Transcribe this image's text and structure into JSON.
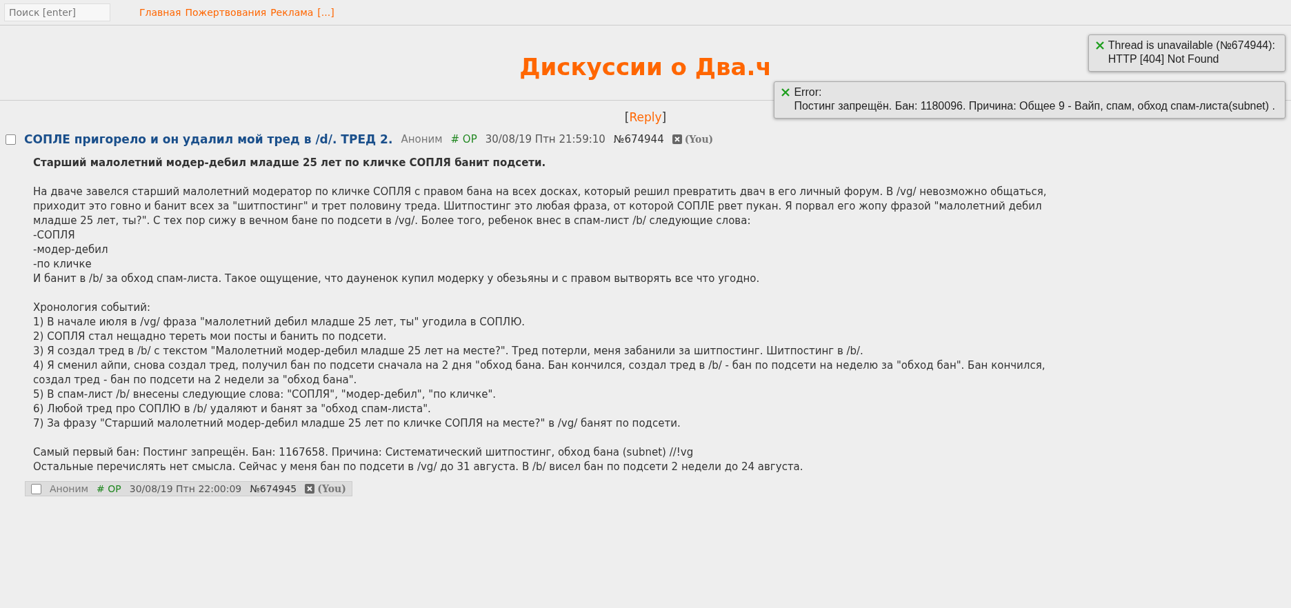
{
  "topbar": {
    "search": {
      "placeholder": "Поиск [enter]"
    },
    "links": [
      "Главная",
      "Пожертвования",
      "Реклама",
      "[...]"
    ]
  },
  "board_title": "Дискуссии о Два.ч",
  "reply_link": {
    "open": "[",
    "label": "Reply",
    "close": "]"
  },
  "notifications": [
    {
      "kind": "error",
      "title": "Thread is unavailable (№674944):",
      "message": "HTTP [404] Not Found"
    },
    {
      "kind": "error",
      "title": "Error:",
      "message": "Постинг запрещён. Бан: 1180096. Причина: Общее 9 - Вайп, спам, обход спам-листа(subnet) ."
    }
  ],
  "op_post": {
    "checked": false,
    "subject": "СОПЛЕ пригорело и он удалил мой тред в /d/. ТРЕД 2.",
    "name": "Аноним",
    "trip": "# OP",
    "date": "30/08/19 Птн 21:59:10",
    "number": "№674944",
    "you": "(You)",
    "heading": "Старший малолетний модер-дебил младше 25 лет по кличке СОПЛЯ банит подсети.",
    "paragraphs": [
      [
        "На дваче завелся старший малолетний модератор по кличке СОПЛЯ с правом бана на всех досках, который решил превратить двач в его личный форум. В /vg/ невозможно общаться,",
        "приходит это говно и банит всех за \"шитпостинг\" и трет половину треда. Шитпостинг это любая фраза, от которой СОПЛЕ рвет пукан. Я порвал его жопу фразой \"малолетний дебил",
        "младше 25 лет, ты?\". С тех пор сижу в вечном бане по подсети в /vg/. Более того, ребенок внес в спам-лист /b/ следующие слова:",
        "-СОПЛЯ",
        "-модер-дебил",
        "-по кличке",
        "И банит в /b/ за обход спам-листа. Такое ощущение, что дауненок купил модерку у обезьяны и с правом вытворять все что угодно."
      ],
      [
        "Хронология событий:",
        "1) В начале июля в /vg/ фраза \"малолетний дебил младше 25 лет, ты\" угодила в СОПЛЮ.",
        "2) СОПЛЯ стал нещадно тереть мои посты и банить по подсети.",
        "3) Я создал тред в /b/ с текстом \"Малолетний модер-дебил младше 25 лет на месте?\". Тред потерли, меня забанили за шитпостинг. Шитпостинг в /b/.",
        "4) Я сменил айпи, снова создал тред, получил бан по подсети сначала на 2 дня \"обход бана. Бан кончился, создал тред в /b/ - бан по подсети на неделю за \"обход бан\". Бан кончился,",
        "создал тред - бан по подсети на 2 недели за \"обход бана\".",
        "5) В спам-лист /b/ внесены следующие слова: \"СОПЛЯ\", \"модер-дебил\", \"по кличке\".",
        "6) Любой тред про СОПЛЮ в /b/ удаляют и банят за \"обход спам-листа\".",
        "7) За фразу \"Старший малолетний модер-дебил младше 25 лет по кличке СОПЛЯ на месте?\" в /vg/ банят по подсети."
      ],
      [
        "Самый первый бан: Постинг запрещён. Бан: 1167658. Причина: Систематический шитпостинг, обход бана (subnet) //!vg",
        "Остальные перечислять нет смысла. Сейчас у меня бан по подсети в /vg/ до 31 августа. В /b/ висел бан по подсети 2 недели до 24 августа."
      ]
    ]
  },
  "reply_post": {
    "checked": false,
    "name": "Аноним",
    "trip": "# OP",
    "date": "30/08/19 Птн 22:00:09",
    "number": "№674945",
    "you": "(You)"
  }
}
